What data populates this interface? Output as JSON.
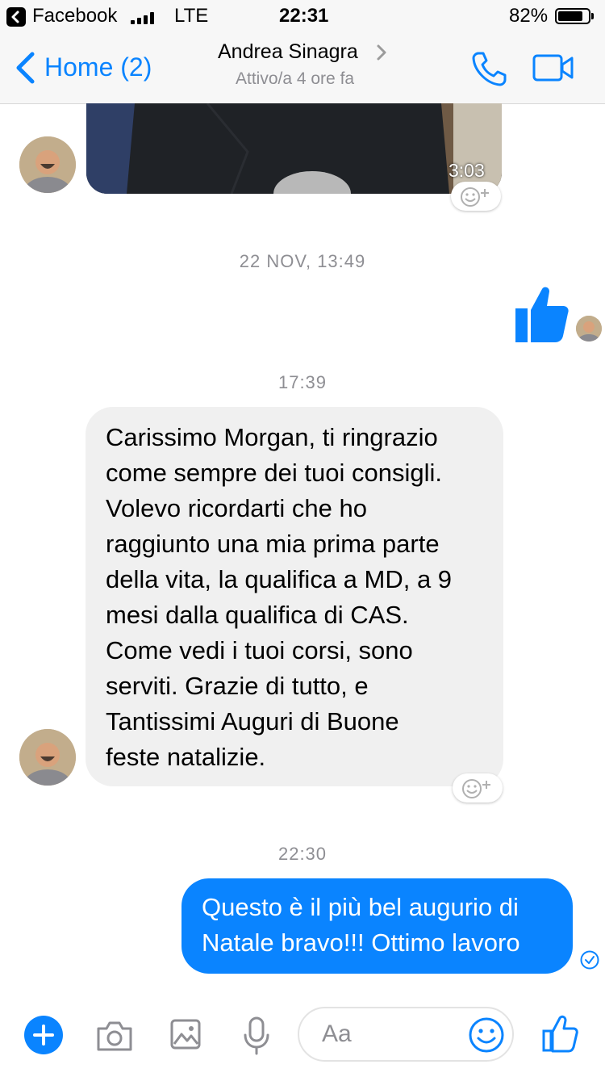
{
  "status_bar": {
    "back_app": "Facebook",
    "network": "LTE",
    "time": "22:31",
    "battery": "82%",
    "battery_level": 0.82
  },
  "nav": {
    "back_label": "Home (2)",
    "contact_name": "Andrea Sinagra",
    "contact_status": "Attivo/a 4 ore fa",
    "icons": [
      "chevron-left-icon",
      "chevron-right-icon",
      "phone-icon",
      "video-camera-icon"
    ]
  },
  "messages": {
    "video_duration": "3:03",
    "timestamp_1": "22 NOV, 13:49",
    "timestamp_2": "17:39",
    "incoming_text": "Carissimo Morgan, ti ringrazio\ncome sempre dei tuoi consigli.\nVolevo ricordarti che ho\nraggiunto una mia prima parte\ndella vita, la qualifica a MD, a 9\nmesi dalla qualifica di CAS.\nCome vedi i tuoi corsi, sono\nserviti. Grazie di tutto, e\nTantissimi Auguri di Buone\nfeste natalizie.",
    "timestamp_3": "22:30",
    "outgoing_text": "Questo è il più bel augurio di\nNatale bravo!!! Ottimo lavoro"
  },
  "composer": {
    "placeholder": "Aa",
    "icons": [
      "plus-icon",
      "camera-icon",
      "image-icon",
      "microphone-icon",
      "emoji-icon",
      "thumbs-up-icon"
    ]
  },
  "colors": {
    "accent": "#0a84ff",
    "incoming_bubble": "#f0f0f0",
    "outgoing_bubble": "#0a84ff",
    "secondary_text": "#8e8e93",
    "bar_background": "#f7f7f7"
  }
}
